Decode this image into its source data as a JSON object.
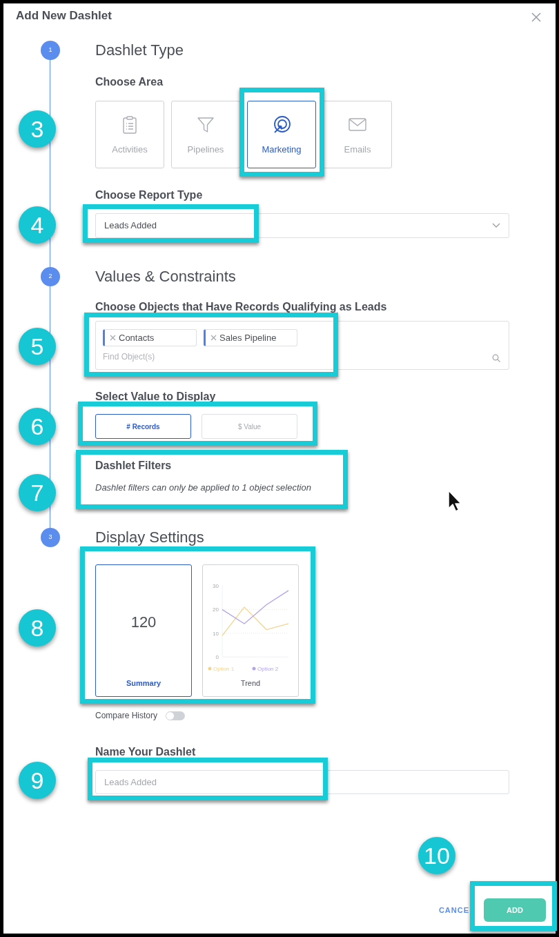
{
  "dialog": {
    "title": "Add New Dashlet"
  },
  "steps": [
    {
      "number": "1",
      "title": "Dashlet Type"
    },
    {
      "number": "2",
      "title": "Values & Constraints"
    },
    {
      "number": "3",
      "title": "Display Settings"
    }
  ],
  "choose_area": {
    "label": "Choose Area",
    "areas": [
      {
        "label": "Activities",
        "selected": false
      },
      {
        "label": "Pipelines",
        "selected": false
      },
      {
        "label": "Marketing",
        "selected": true
      },
      {
        "label": "Emails",
        "selected": false
      }
    ]
  },
  "report_type": {
    "label": "Choose Report Type",
    "value": "Leads Added"
  },
  "objects": {
    "label": "Choose Objects that Have Records Qualifying as Leads",
    "tags": [
      "Contacts",
      "Sales Pipeline"
    ],
    "placeholder": "Find Object(s)"
  },
  "value_display": {
    "label": "Select Value to Display",
    "options": [
      {
        "label": "# Records",
        "selected": true
      },
      {
        "label": "$ Value",
        "selected": false
      }
    ]
  },
  "filters": {
    "title": "Dashlet Filters",
    "note": "Dashlet filters can only be applied to 1 object selection"
  },
  "display": {
    "options": [
      {
        "kind": "summary",
        "label": "Summary",
        "value": "120",
        "selected": true
      },
      {
        "kind": "trend",
        "label": "Trend",
        "selected": false,
        "chart_data": {
          "type": "line",
          "ylim": [
            0,
            30
          ],
          "yticks": [
            0,
            10,
            20,
            30
          ],
          "series": [
            {
              "name": "Option 1",
              "color": "#f2d48e",
              "values": [
                9,
                21,
                11.5,
                14
              ]
            },
            {
              "name": "Option 2",
              "color": "#b4a4e8",
              "values": [
                20,
                14,
                22,
                28
              ]
            }
          ]
        }
      }
    ],
    "compare_history": {
      "label": "Compare History",
      "on": false
    }
  },
  "name": {
    "label": "Name Your Dashlet",
    "placeholder": "Leads Added"
  },
  "footer": {
    "cancel": "CANCE",
    "add": "ADD"
  },
  "callouts": [
    "3",
    "4",
    "5",
    "6",
    "7",
    "8",
    "9",
    "10"
  ]
}
